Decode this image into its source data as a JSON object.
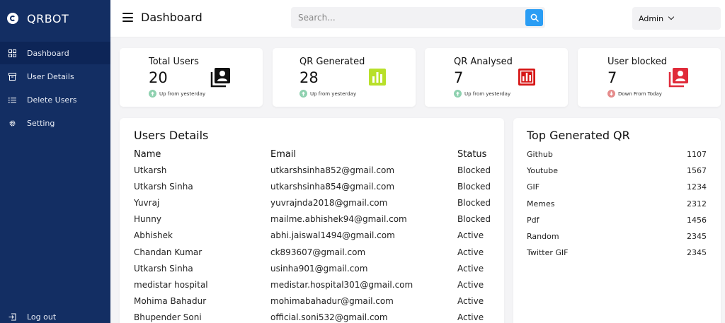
{
  "app": {
    "brand": "QRBOT"
  },
  "sidebar": {
    "items": [
      {
        "label": "Dashboard",
        "icon": "grid-icon"
      },
      {
        "label": "User Details",
        "icon": "archive-icon"
      },
      {
        "label": "Delete Users",
        "icon": "list-icon"
      },
      {
        "label": "Setting",
        "icon": "gear-icon"
      }
    ],
    "logout_label": "Log out"
  },
  "header": {
    "title": "Dashboard",
    "search_placeholder": "Search...",
    "user_label": "Admin"
  },
  "stats": [
    {
      "title": "Total Users",
      "value": "20",
      "trend": "Up from yesterday",
      "direction": "up",
      "icon_color": "#111111"
    },
    {
      "title": "QR Generated",
      "value": "28",
      "trend": "Up from yesterday",
      "direction": "up",
      "icon_color": "#b8e02a"
    },
    {
      "title": "QR Analysed",
      "value": "7",
      "trend": "Up from yesterday",
      "direction": "up",
      "icon_color": "#d61515"
    },
    {
      "title": "User blocked",
      "value": "7",
      "trend": "Down From Today",
      "direction": "down",
      "icon_color": "#e02b3a"
    }
  ],
  "users": {
    "title": "Users Details",
    "columns": [
      "Name",
      "Email",
      "Status"
    ],
    "rows": [
      {
        "name": "Utkarsh",
        "email": "utkarshsinha852@gmail.com",
        "status": "Blocked"
      },
      {
        "name": "Utkarsh Sinha",
        "email": "utkarshsinha854@gmail.com",
        "status": "Blocked"
      },
      {
        "name": "Yuvraj",
        "email": "yuvrajnda2018@gmail.com",
        "status": "Blocked"
      },
      {
        "name": "Hunny",
        "email": "mailme.abhishek94@gmail.com",
        "status": "Blocked"
      },
      {
        "name": "Abhishek",
        "email": "abhi.jaiswal1494@gmail.com",
        "status": "Active"
      },
      {
        "name": "Chandan Kumar",
        "email": "ck893607@gmail.com",
        "status": "Active"
      },
      {
        "name": "Utkarsh Sinha",
        "email": "usinha901@gmail.com",
        "status": "Active"
      },
      {
        "name": "medistar hospital",
        "email": "medistar.hospital301@gmail.com",
        "status": "Active"
      },
      {
        "name": "Mohima Bahadur",
        "email": "mohimabahadur@gmail.com",
        "status": "Active"
      },
      {
        "name": "Bhupender Soni",
        "email": "official.soni532@gmail.com",
        "status": "Active"
      }
    ]
  },
  "top_qr": {
    "title": "Top Generated QR",
    "items": [
      {
        "label": "Github",
        "count": "1107"
      },
      {
        "label": "Youtube",
        "count": "1567"
      },
      {
        "label": "GIF",
        "count": "1234"
      },
      {
        "label": "Memes",
        "count": "2312"
      },
      {
        "label": "Pdf",
        "count": "1456"
      },
      {
        "label": "Random",
        "count": "2345"
      },
      {
        "label": "Twitter GIF",
        "count": "2345"
      }
    ]
  },
  "colors": {
    "sidebar_bg": "#132e63",
    "search_button": "#2a9df4",
    "trend_up": "#8fd1b0",
    "trend_down": "#e58b8b",
    "blocked": "#d61515",
    "active": "#1f2fa8"
  }
}
